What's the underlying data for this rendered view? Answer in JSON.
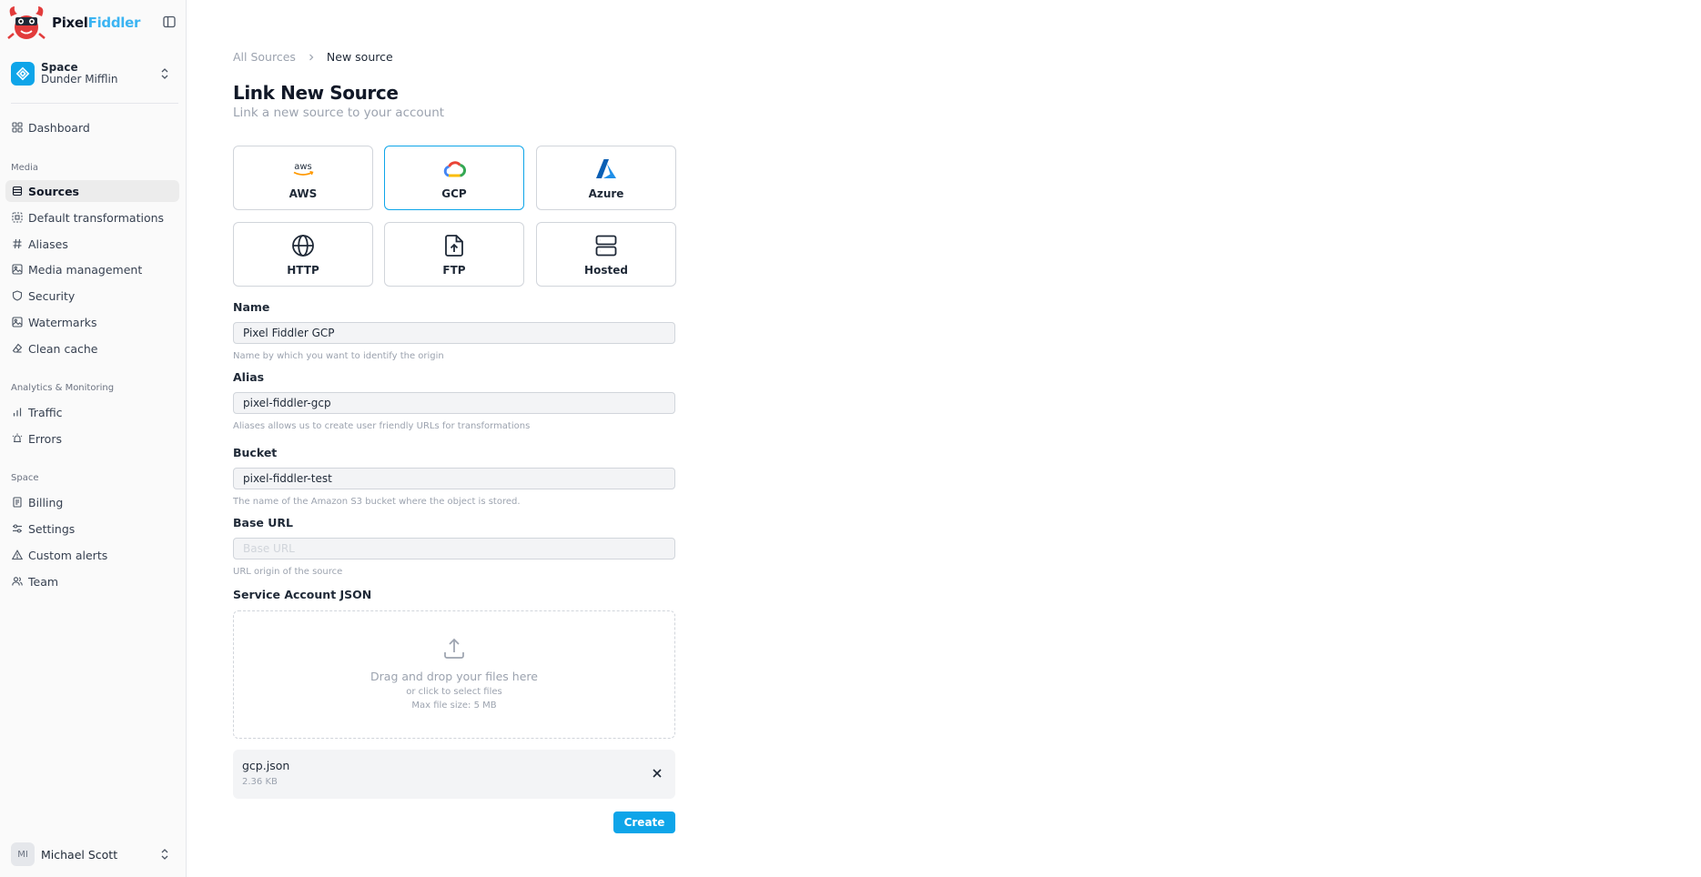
{
  "brand": {
    "name_part1": "Pixel",
    "name_part2": "Fiddler"
  },
  "space_switcher": {
    "label": "Space",
    "value": "Dunder Mifflin"
  },
  "sidebar": {
    "dashboard": "Dashboard",
    "section_media": "Media",
    "media_items": [
      "Sources",
      "Default transformations",
      "Aliases",
      "Media management",
      "Security",
      "Watermarks",
      "Clean cache"
    ],
    "section_analytics": "Analytics & Monitoring",
    "analytics_items": [
      "Traffic",
      "Errors"
    ],
    "section_space": "Space",
    "space_items": [
      "Billing",
      "Settings",
      "Custom alerts",
      "Team"
    ],
    "active_item": "Sources"
  },
  "user": {
    "initials": "MI",
    "name": "Michael Scott"
  },
  "breadcrumb": {
    "parent": "All Sources",
    "current": "New source"
  },
  "page": {
    "title": "Link New Source",
    "subtitle": "Link a new source to your account"
  },
  "providers": [
    {
      "label": "AWS",
      "icon": "aws-icon"
    },
    {
      "label": "GCP",
      "icon": "gcp-cloud-icon",
      "selected": true
    },
    {
      "label": "Azure",
      "icon": "azure-icon"
    },
    {
      "label": "HTTP",
      "icon": "globe-icon"
    },
    {
      "label": "FTP",
      "icon": "file-upload-icon"
    },
    {
      "label": "Hosted",
      "icon": "server-icon"
    }
  ],
  "form": {
    "name": {
      "label": "Name",
      "value": "Pixel Fiddler GCP",
      "help": "Name by which you want to identify the origin"
    },
    "alias": {
      "label": "Alias",
      "value": "pixel-fiddler-gcp",
      "help": "Aliases allows us to create user friendly URLs for transformations"
    },
    "bucket": {
      "label": "Bucket",
      "value": "pixel-fiddler-test",
      "help": "The name of the Amazon S3 bucket where the object is stored."
    },
    "base_url": {
      "label": "Base URL",
      "value": "",
      "placeholder": "Base URL",
      "help": "URL origin of the source"
    },
    "service_account": {
      "label": "Service Account JSON",
      "drop_title": "Drag and drop your files here",
      "drop_sub": "or click to select files",
      "drop_max": "Max file size: 5 MB"
    },
    "file": {
      "name": "gcp.json",
      "size": "2.36 KB"
    },
    "submit": "Create"
  },
  "colors": {
    "accent": "#0ea5e9",
    "brand_accent": "#3bb4f2"
  }
}
